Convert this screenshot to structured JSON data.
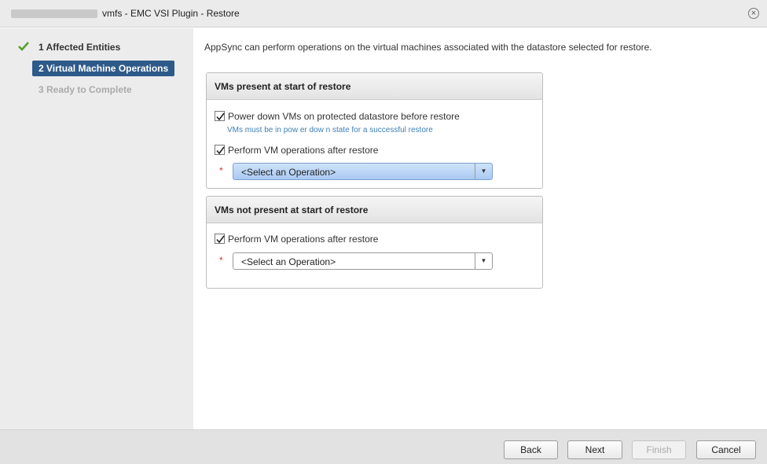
{
  "window": {
    "title": "vmfs - EMC VSI Plugin - Restore",
    "close_label": "×"
  },
  "steps": [
    {
      "label": "1  Affected Entities",
      "state": "complete"
    },
    {
      "label": "2  Virtual Machine Operations",
      "state": "active"
    },
    {
      "label": "3  Ready to Complete",
      "state": "disabled"
    }
  ],
  "main": {
    "intro": "AppSync can perform operations on the virtual machines associated with the datastore selected for restore.",
    "panel1": {
      "title": "VMs present at start of restore",
      "power_down_label": "Power down VMs on protected datastore before restore",
      "power_down_checked": true,
      "power_down_hint": "VMs must be in pow er dow n state for a successful restore",
      "perform_ops_label": "Perform VM operations after restore",
      "perform_ops_checked": true,
      "required_mark": "*",
      "select_value": "<Select an Operation>"
    },
    "panel2": {
      "title": "VMs not present at start of restore",
      "perform_ops_label": "Perform VM operations after restore",
      "perform_ops_checked": true,
      "required_mark": "*",
      "select_value": "<Select an Operation>"
    }
  },
  "footer": {
    "back": "Back",
    "next": "Next",
    "finish": "Finish",
    "cancel": "Cancel"
  },
  "colors": {
    "active_step": "#2e5a8a",
    "check_green": "#5aa02c",
    "hint_blue": "#3f7fb5",
    "required_red": "#d33333"
  }
}
